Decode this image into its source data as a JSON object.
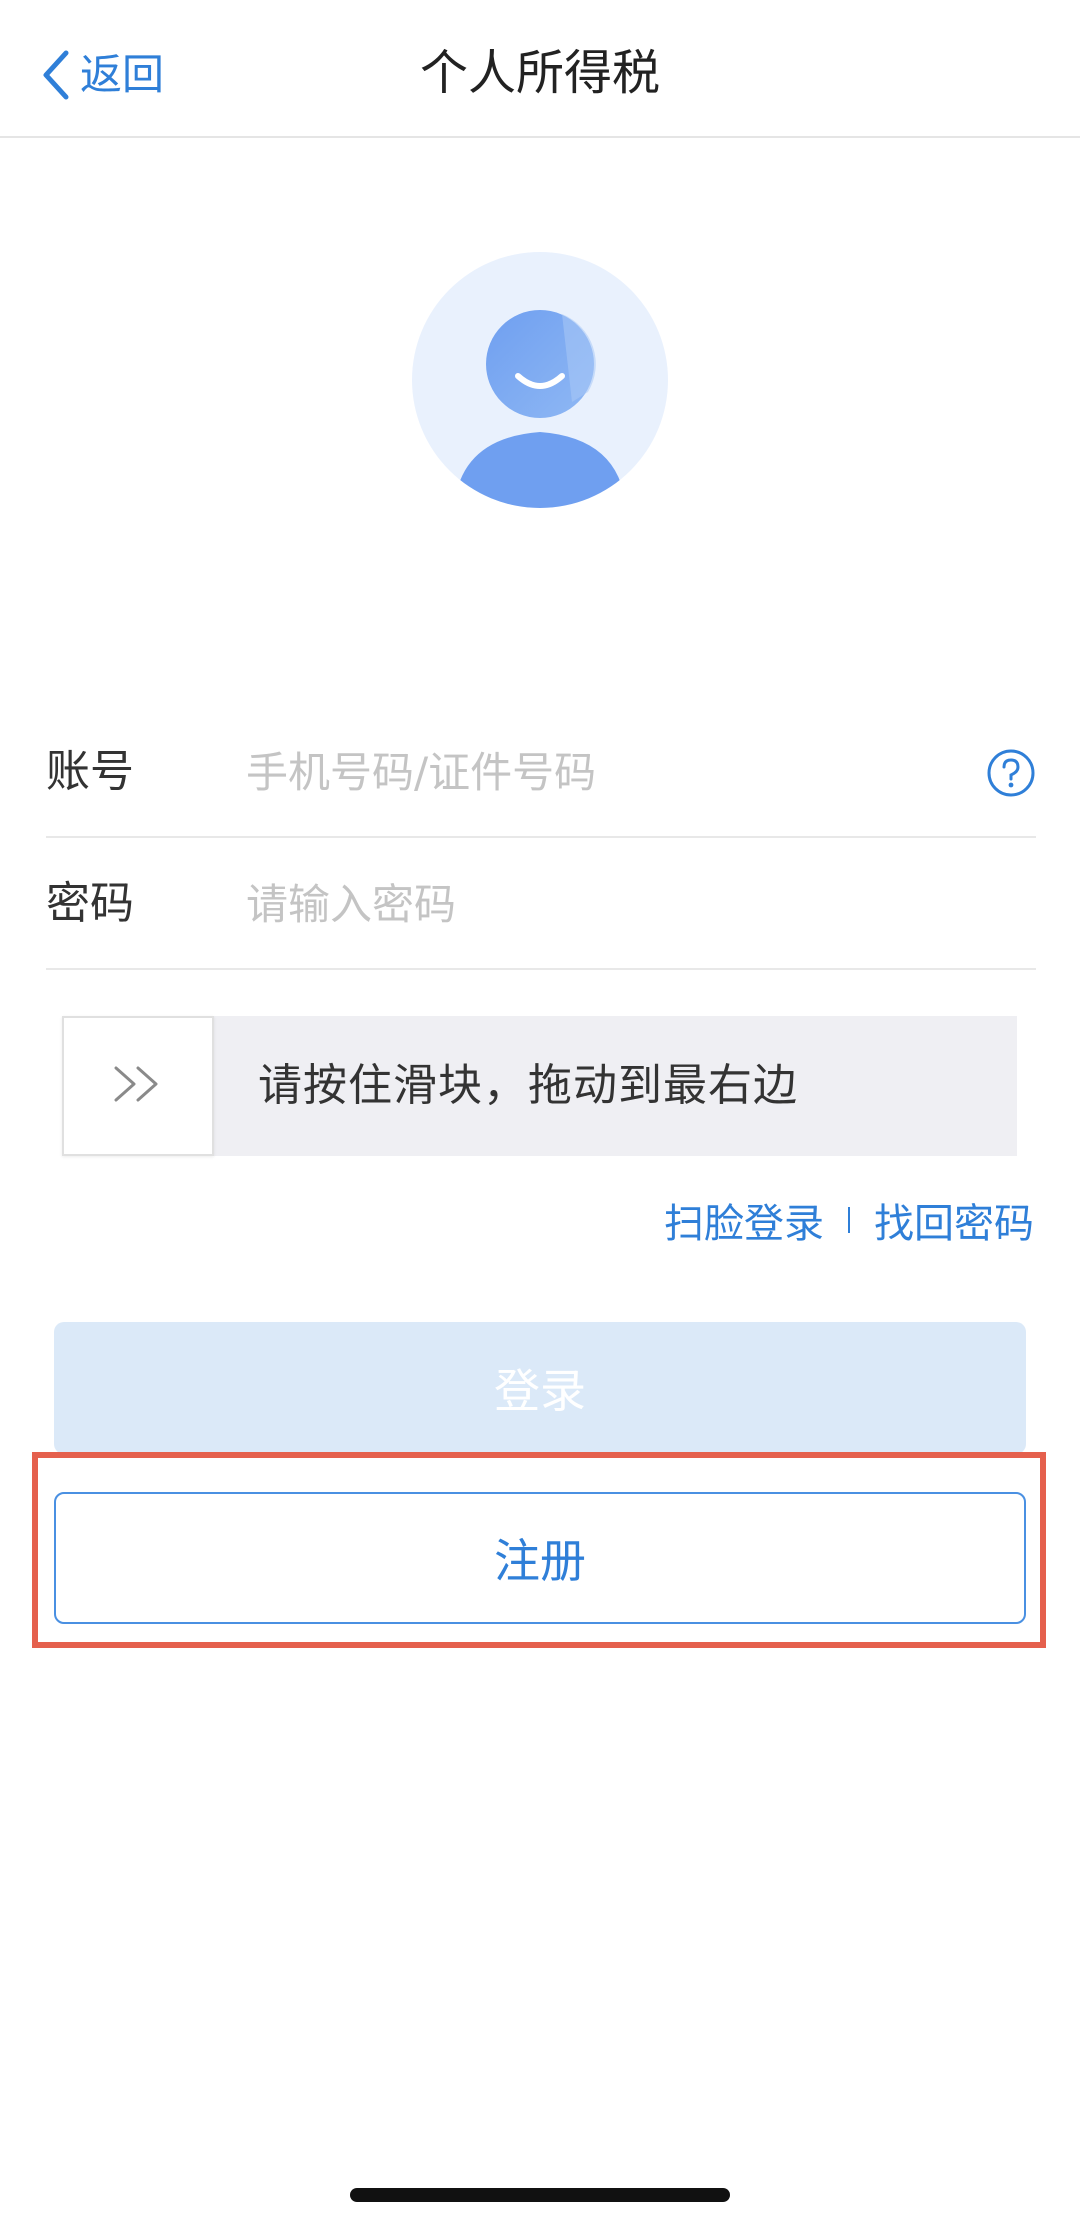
{
  "navbar": {
    "back_label": "返回",
    "title": "个人所得税",
    "back_icon": "chevron-left-icon"
  },
  "avatar": {
    "icon": "user-avatar-icon",
    "bg_color": "#e9f1fd",
    "figure_color": "#7aa9f0"
  },
  "form": {
    "account": {
      "label": "账号",
      "placeholder": "手机号码/证件号码",
      "value": "",
      "help_icon": "question-circle-icon"
    },
    "password": {
      "label": "密码",
      "placeholder": "请输入密码",
      "value": ""
    }
  },
  "slider": {
    "text": "请按住滑块，拖动到最右边",
    "handle_icon": "double-chevron-right-icon",
    "progress": 0
  },
  "links": {
    "face_login": "扫脸登录",
    "find_password": "找回密码"
  },
  "buttons": {
    "login": "登录",
    "register": "注册"
  },
  "colors": {
    "accent": "#2f7fd8",
    "login_disabled_bg": "#dbe9f8",
    "highlight": "#e5604d"
  }
}
